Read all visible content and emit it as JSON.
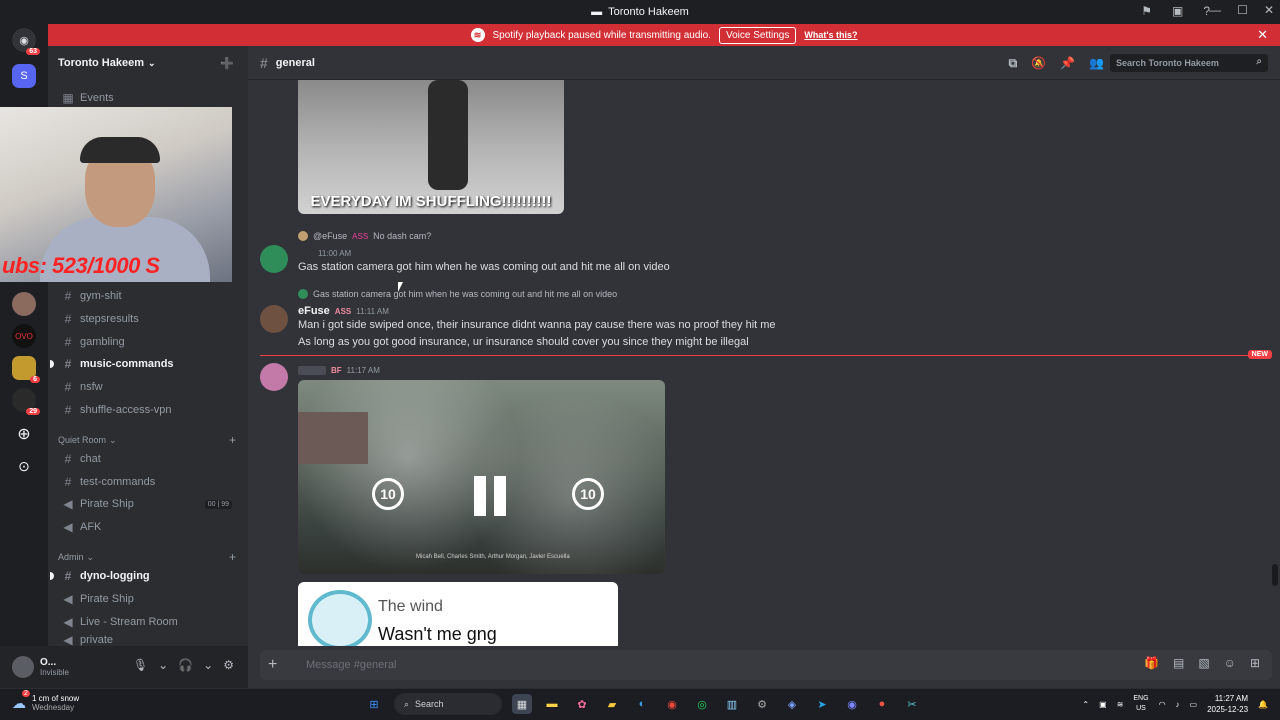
{
  "window": {
    "title": "Toronto Hakeem"
  },
  "banner": {
    "text": "Spotify playback paused while transmitting audio.",
    "button": "Voice Settings",
    "link": "What's this?"
  },
  "server_rail": {
    "home_badge": "63",
    "badges": [
      "6",
      "29"
    ]
  },
  "server": {
    "name": "Toronto Hakeem",
    "channels_top": [
      {
        "label": "Events",
        "icon": "calendar-icon"
      }
    ],
    "channels": [
      {
        "label": "gym-shit",
        "icon": "hash",
        "bold": false
      },
      {
        "label": "stepsresults",
        "icon": "hash",
        "bold": false
      },
      {
        "label": "gambling",
        "icon": "hash",
        "bold": false
      },
      {
        "label": "music-commands",
        "icon": "hash",
        "bold": true
      },
      {
        "label": "nsfw",
        "icon": "hash",
        "bold": false
      },
      {
        "label": "shuffle-access-vpn",
        "icon": "hash",
        "bold": false
      }
    ],
    "quiet_room": {
      "label": "Quiet Room",
      "channels": [
        {
          "label": "chat",
          "icon": "hash"
        },
        {
          "label": "test-commands",
          "icon": "hash"
        },
        {
          "label": "Pirate Ship",
          "icon": "speaker",
          "counts": [
            "00",
            "99"
          ]
        },
        {
          "label": "AFK",
          "icon": "speaker"
        }
      ]
    },
    "admin": {
      "label": "Admin",
      "channels": [
        {
          "label": "dyno-logging",
          "icon": "hash",
          "bold": true
        },
        {
          "label": "Pirate Ship",
          "icon": "speaker"
        },
        {
          "label": "Live - Stream Room",
          "icon": "speaker"
        },
        {
          "label": "private",
          "icon": "speaker"
        }
      ]
    }
  },
  "webcam": {
    "counter": "ubs: 523/1000  S"
  },
  "channel": {
    "name": "general",
    "search_placeholder": "Search Toronto Hakeem"
  },
  "messages": {
    "media1_caption": "EVERYDAY IM SHUFFLING!!!!!!!!!!",
    "reply1": {
      "user": "@eFuse",
      "tag": "ASS",
      "text": "No dash cam?"
    },
    "msg1": {
      "time": "11:00 AM",
      "text": "Gas station camera got him when he was coming out and hit me all on video"
    },
    "reply2": {
      "text": "Gas station camera got him when he was coming out and hit me all on video"
    },
    "msg2": {
      "user": "eFuse",
      "tag": "ASS",
      "time": "11:11 AM",
      "lines": [
        "Man i got side swiped once, their insurance didnt wanna pay cause there was no proof they hit me",
        "As long as you got good insurance, ur insurance should cover you since they might be illegal"
      ]
    },
    "new_label": "NEW",
    "msg3": {
      "tag": "BF",
      "time": "11:17 AM"
    },
    "video": {
      "skip_back": "10",
      "skip_fwd": "10",
      "credit": "Micah Bell, Charles Smith, Arthur Morgan, Javier Escuella"
    },
    "media3": {
      "line1": "The wind",
      "line2": "Wasn't me gng"
    }
  },
  "composer": {
    "placeholder": "Message #general"
  },
  "user_panel": {
    "name": "O...",
    "status": "Invisible"
  },
  "taskbar": {
    "weather_count": "2",
    "weather_line1": "1 cm of snow",
    "weather_line2": "Wednesday",
    "search": "Search",
    "lang1": "ENG",
    "lang2": "US",
    "time": "11:27 AM",
    "date": "2025-12-23"
  }
}
